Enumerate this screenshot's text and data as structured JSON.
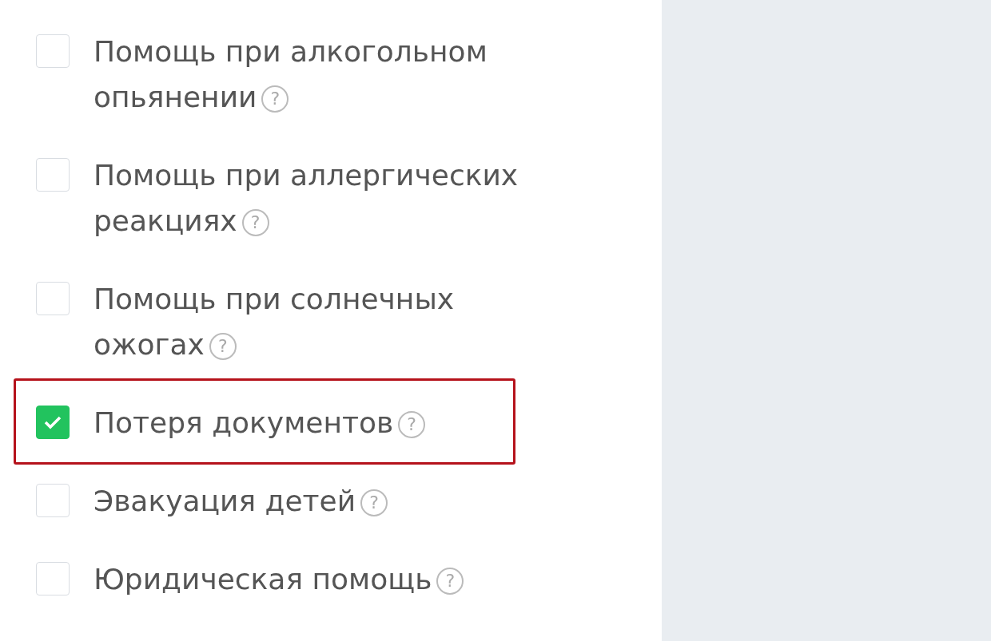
{
  "options": [
    {
      "label": "Помощь при алкогольном опьянении",
      "hint_icon": "?",
      "checked": false,
      "highlighted": false
    },
    {
      "label": "Помощь при аллергических реакциях",
      "hint_icon": "?",
      "checked": false,
      "highlighted": false
    },
    {
      "label": "Помощь при солнечных ожогах",
      "hint_icon": "?",
      "checked": false,
      "highlighted": false
    },
    {
      "label": "Потеря документов",
      "hint_icon": "?",
      "checked": true,
      "highlighted": true
    },
    {
      "label": "Эвакуация детей",
      "hint_icon": "?",
      "checked": false,
      "highlighted": false
    },
    {
      "label": "Юридическая помощь",
      "hint_icon": "?",
      "checked": false,
      "highlighted": false
    }
  ]
}
